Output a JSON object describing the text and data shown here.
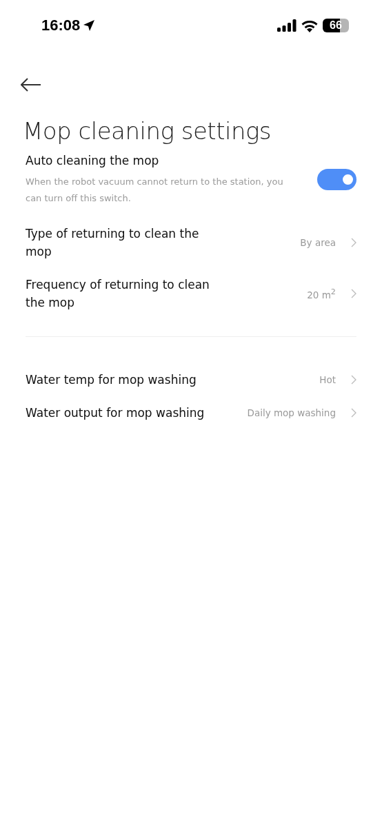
{
  "status_bar": {
    "time": "16:08",
    "battery": "66"
  },
  "title": "Mop cleaning settings",
  "sections": [
    {
      "items": [
        {
          "kind": "toggle",
          "label": "Auto cleaning the mop",
          "description": "When the robot vacuum cannot return to the station, you can turn off this switch.",
          "on": true
        },
        {
          "kind": "link",
          "label": "Type of returning to clean the mop",
          "value": "By area"
        },
        {
          "kind": "link",
          "label": "Frequency of returning to clean the mop",
          "value": "20 m$^{2}$"
        }
      ]
    },
    {
      "items": [
        {
          "kind": "link",
          "label": "Water temp for mop washing",
          "value": "Hot"
        },
        {
          "kind": "link",
          "label": "Water output for mop washing",
          "value": "Daily mop washing"
        }
      ]
    }
  ]
}
